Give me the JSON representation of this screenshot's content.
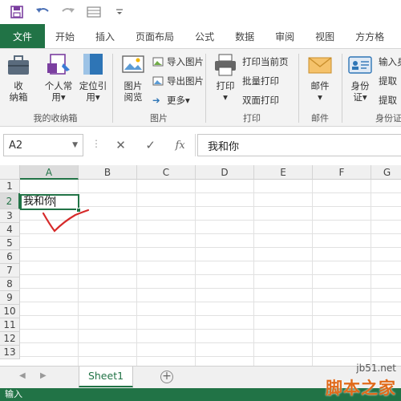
{
  "qat": {
    "icons": [
      "save-icon",
      "undo-icon",
      "redo-icon",
      "form-icon",
      "customize-icon"
    ]
  },
  "tabs": [
    "文件",
    "开始",
    "插入",
    "页面布局",
    "公式",
    "数据",
    "审阅",
    "视图",
    "方方格"
  ],
  "ribbon": {
    "groups": {
      "collection": {
        "label": "我的收纳箱",
        "storage_box": "收\n纳箱",
        "personal": "个人常\n用▾",
        "locate": "定位引\n用▾"
      },
      "picture": {
        "label": "图片",
        "browse": "图片\n阅览",
        "import": "导入图片",
        "export": "导出图片",
        "more": "更多▾"
      },
      "print": {
        "label": "打印",
        "print": "打印\n▾",
        "print_current": "打印当前页",
        "batch": "批量打印",
        "duplex": "双面打印"
      },
      "mail": {
        "label": "邮件",
        "mail": "邮件\n▾"
      },
      "id": {
        "label": "身份证",
        "id_card": "身份\n证▾",
        "input": "输入身",
        "extract1": "提取",
        "extract2": "提取"
      }
    }
  },
  "formula_bar": {
    "name_box": "A2",
    "formula_value": "我和你",
    "icons": [
      "cancel-icon",
      "confirm-icon",
      "function-icon"
    ],
    "fx": "fx"
  },
  "grid": {
    "columns": [
      "A",
      "B",
      "C",
      "D",
      "E",
      "F",
      "G"
    ],
    "rows": [
      "1",
      "2",
      "3",
      "4",
      "5",
      "6",
      "7",
      "8",
      "9",
      "10",
      "11",
      "12",
      "13"
    ],
    "active_cell_text": "我和你"
  },
  "sheets": {
    "tabs": [
      "Sheet1"
    ],
    "add": "+"
  },
  "status": "输入",
  "watermark": {
    "url": "jb51.net",
    "brand": "脚本之家"
  },
  "colors": {
    "excel_green": "#217346",
    "annotation_red": "#d62a2a",
    "watermark_orange": "#e06a1a"
  }
}
